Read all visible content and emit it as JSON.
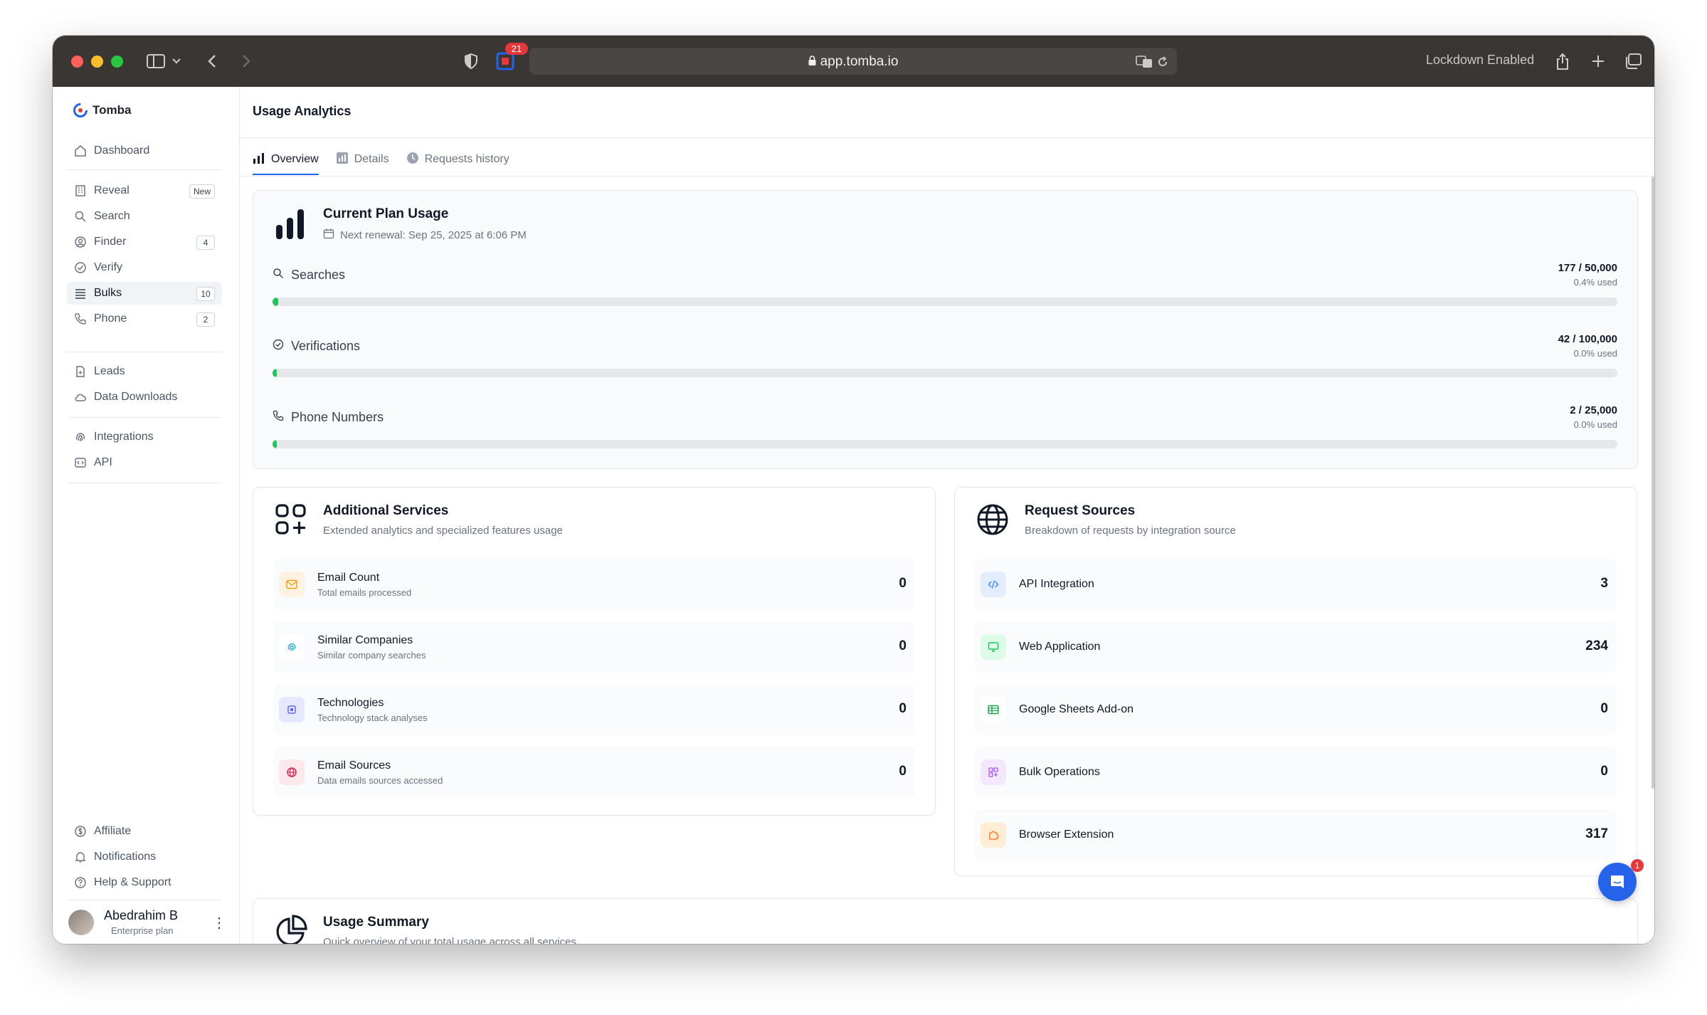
{
  "browser": {
    "url": "app.tomba.io",
    "extension_badge": "21",
    "lockdown_label": "Lockdown Enabled"
  },
  "brand": {
    "name": "Tomba"
  },
  "sidebar": {
    "items": [
      {
        "label": "Dashboard",
        "icon": "home-icon"
      },
      {
        "label": "Reveal",
        "icon": "building-icon",
        "badge": "New"
      },
      {
        "label": "Search",
        "icon": "search-icon"
      },
      {
        "label": "Finder",
        "icon": "user-circle-icon",
        "badge": "4"
      },
      {
        "label": "Verify",
        "icon": "check-circle-icon"
      },
      {
        "label": "Bulks",
        "icon": "list-icon",
        "badge": "10",
        "active": true
      },
      {
        "label": "Phone",
        "icon": "phone-icon",
        "badge": "2"
      },
      {
        "label": "Leads",
        "icon": "file-icon"
      },
      {
        "label": "Data Downloads",
        "icon": "cloud-icon"
      },
      {
        "label": "Integrations",
        "icon": "fingerprint-icon"
      },
      {
        "label": "API",
        "icon": "code-icon"
      },
      {
        "label": "Affiliate",
        "icon": "dollar-circle-icon"
      },
      {
        "label": "Notifications",
        "icon": "bell-icon"
      },
      {
        "label": "Help & Support",
        "icon": "question-circle-icon"
      }
    ],
    "user": {
      "name": "Abedrahim B",
      "plan": "Enterprise plan"
    }
  },
  "page": {
    "title": "Usage Analytics",
    "tabs": [
      {
        "label": "Overview",
        "active": true
      },
      {
        "label": "Details"
      },
      {
        "label": "Requests history"
      }
    ]
  },
  "plan_usage": {
    "title": "Current Plan Usage",
    "renewal": "Next renewal: Sep 25, 2025 at 6:06 PM",
    "items": [
      {
        "label": "Searches",
        "value": "177 / 50,000",
        "percent_label": "0.4% used",
        "fraction": 0.004
      },
      {
        "label": "Verifications",
        "value": "42 / 100,000",
        "percent_label": "0.0% used",
        "fraction": 0.0
      },
      {
        "label": "Phone Numbers",
        "value": "2 / 25,000",
        "percent_label": "0.0% used",
        "fraction": 0.0
      }
    ]
  },
  "additional_services": {
    "title": "Additional Services",
    "subtitle": "Extended analytics and specialized features usage",
    "items": [
      {
        "name": "Email Count",
        "desc": "Total emails processed",
        "count": "0",
        "icon": "mail-icon",
        "color": "#f59e0b"
      },
      {
        "name": "Similar Companies",
        "desc": "Similar company searches",
        "count": "0",
        "icon": "fingerprint-icon",
        "color": "#0ea5e9"
      },
      {
        "name": "Technologies",
        "desc": "Technology stack analyses",
        "count": "0",
        "icon": "cpu-icon",
        "color": "#6366f1"
      },
      {
        "name": "Email Sources",
        "desc": "Data emails sources accessed",
        "count": "0",
        "icon": "globe-icon",
        "color": "#e11d48"
      }
    ]
  },
  "request_sources": {
    "title": "Request Sources",
    "subtitle": "Breakdown of requests by integration source",
    "items": [
      {
        "name": "API Integration",
        "count": "3",
        "icon": "code-icon",
        "color": "#3b82f6"
      },
      {
        "name": "Web Application",
        "count": "234",
        "icon": "monitor-icon",
        "color": "#22c55e"
      },
      {
        "name": "Google Sheets Add-on",
        "count": "0",
        "icon": "sheet-icon",
        "color": "#16a34a"
      },
      {
        "name": "Bulk Operations",
        "count": "0",
        "icon": "grid-icon",
        "color": "#a855f7"
      },
      {
        "name": "Browser Extension",
        "count": "317",
        "icon": "puzzle-icon",
        "color": "#f97316"
      }
    ]
  },
  "usage_summary": {
    "title": "Usage Summary",
    "subtitle": "Quick overview of your total usage across all services"
  },
  "chat": {
    "badge": "1"
  }
}
